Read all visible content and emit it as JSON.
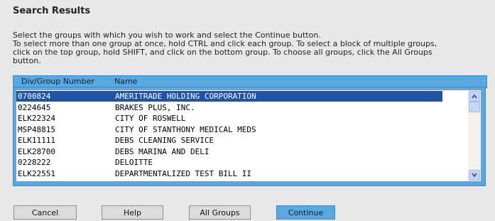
{
  "header": {
    "title": "Search Results"
  },
  "instructions": [
    "Select the groups with which you wish to work and select the Continue button.",
    "To select more than one group at once, hold CTRL and click each group. To select a block of multiple groups,",
    "click on the top group, hold SHIFT, and click on the bottom group. To choose all groups, click the All Groups",
    "button."
  ],
  "table": {
    "columns": [
      "Div/Group Number",
      "Name"
    ],
    "selected_index": 0,
    "rows": [
      {
        "number": "0700824",
        "name": "AMERITRADE HOLDING CORPORATION"
      },
      {
        "number": "0224645",
        "name": "BRAKES PLUS, INC."
      },
      {
        "number": "ELK22324",
        "name": "CITY OF ROSWELL"
      },
      {
        "number": "MSP48815",
        "name": "CITY OF STANTHONY MEDICAL MEDS"
      },
      {
        "number": "ELK11111",
        "name": "DEBS CLEANING SERVICE"
      },
      {
        "number": "ELK28700",
        "name": "DEBS MARINA AND DELI"
      },
      {
        "number": "0228222",
        "name": "DELOITTE"
      },
      {
        "number": "ELK22551",
        "name": "DEPARTMENTALIZED TEST BILL II"
      }
    ]
  },
  "buttons": {
    "cancel": "Cancel",
    "help": "Help",
    "all_groups": "All Groups",
    "continue": "Continue"
  },
  "colors": {
    "header_bg": "#5aa8e0",
    "selected_row": "#2153a4",
    "page_bg": "#e8e8e8"
  },
  "icons": {
    "scroll_up": "arrow-up-icon",
    "scroll_down": "arrow-down-icon"
  }
}
